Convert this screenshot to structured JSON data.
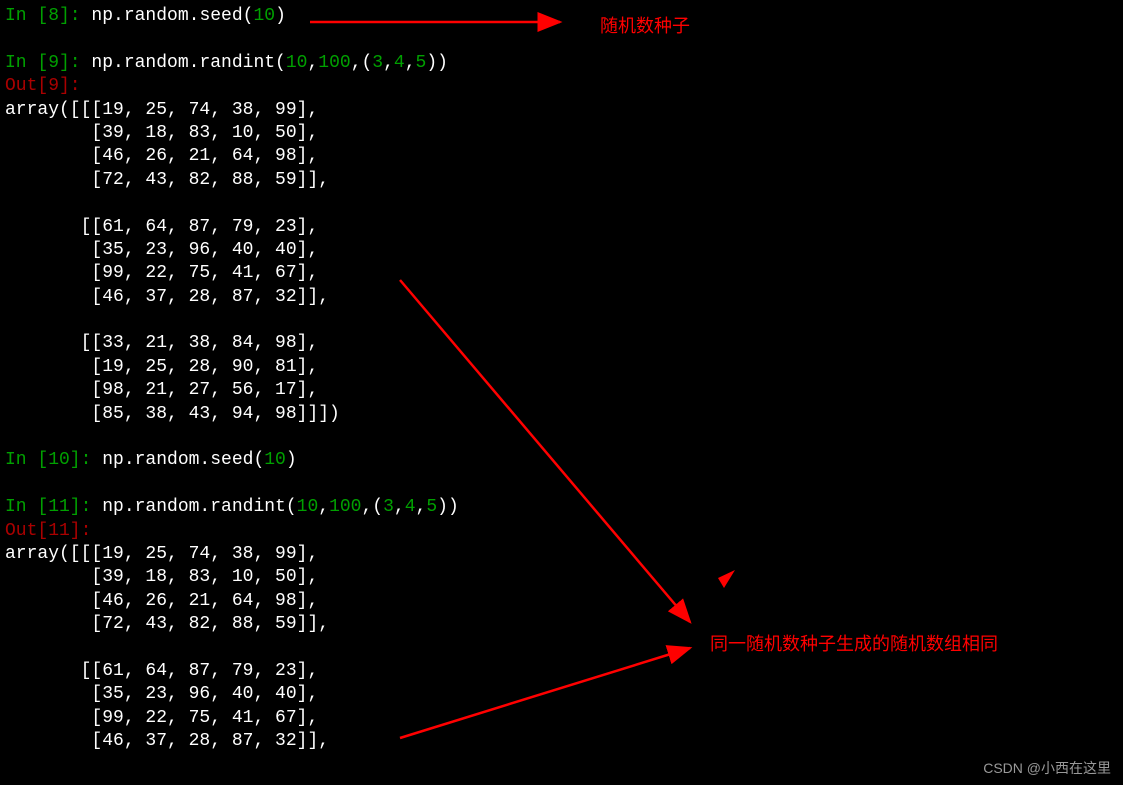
{
  "cells": {
    "c8": {
      "prompt": "In [8]: ",
      "code_pre": "np.random.seed(",
      "arg": "10",
      "code_post": ")"
    },
    "c9": {
      "prompt": "In [9]: ",
      "code_pre": "np.random.randint(",
      "a1": "10",
      "comma1": ",",
      "a2": "100",
      "comma2": ",(",
      "a3": "3",
      "comma3": ",",
      "a4": "4",
      "comma4": ",",
      "a5": "5",
      "code_post": "))"
    },
    "out9": "Out[9]:",
    "arr9_l0": "array([[[19, 25, 74, 38, 99],",
    "arr9_l1": "        [39, 18, 83, 10, 50],",
    "arr9_l2": "        [46, 26, 21, 64, 98],",
    "arr9_l3": "        [72, 43, 82, 88, 59]],",
    "arr9_l4": "",
    "arr9_l5": "       [[61, 64, 87, 79, 23],",
    "arr9_l6": "        [35, 23, 96, 40, 40],",
    "arr9_l7": "        [99, 22, 75, 41, 67],",
    "arr9_l8": "        [46, 37, 28, 87, 32]],",
    "arr9_l9": "",
    "arr9_l10": "       [[33, 21, 38, 84, 98],",
    "arr9_l11": "        [19, 25, 28, 90, 81],",
    "arr9_l12": "        [98, 21, 27, 56, 17],",
    "arr9_l13": "        [85, 38, 43, 94, 98]]])",
    "c10": {
      "prompt": "In [10]: ",
      "code_pre": "np.random.seed(",
      "arg": "10",
      "code_post": ")"
    },
    "c11": {
      "prompt": "In [11]: ",
      "code_pre": "np.random.randint(",
      "a1": "10",
      "comma1": ",",
      "a2": "100",
      "comma2": ",(",
      "a3": "3",
      "comma3": ",",
      "a4": "4",
      "comma4": ",",
      "a5": "5",
      "code_post": "))"
    },
    "out11": "Out[11]:",
    "arr11_l0": "array([[[19, 25, 74, 38, 99],",
    "arr11_l1": "        [39, 18, 83, 10, 50],",
    "arr11_l2": "        [46, 26, 21, 64, 98],",
    "arr11_l3": "        [72, 43, 82, 88, 59]],",
    "arr11_l4": "",
    "arr11_l5": "       [[61, 64, 87, 79, 23],",
    "arr11_l6": "        [35, 23, 96, 40, 40],",
    "arr11_l7": "        [99, 22, 75, 41, 67],",
    "arr11_l8": "        [46, 37, 28, 87, 32]],"
  },
  "annotations": {
    "seed_label": "随机数种子",
    "same_label": "同一随机数种子生成的随机数组相同"
  },
  "watermark": "CSDN @小西在这里"
}
